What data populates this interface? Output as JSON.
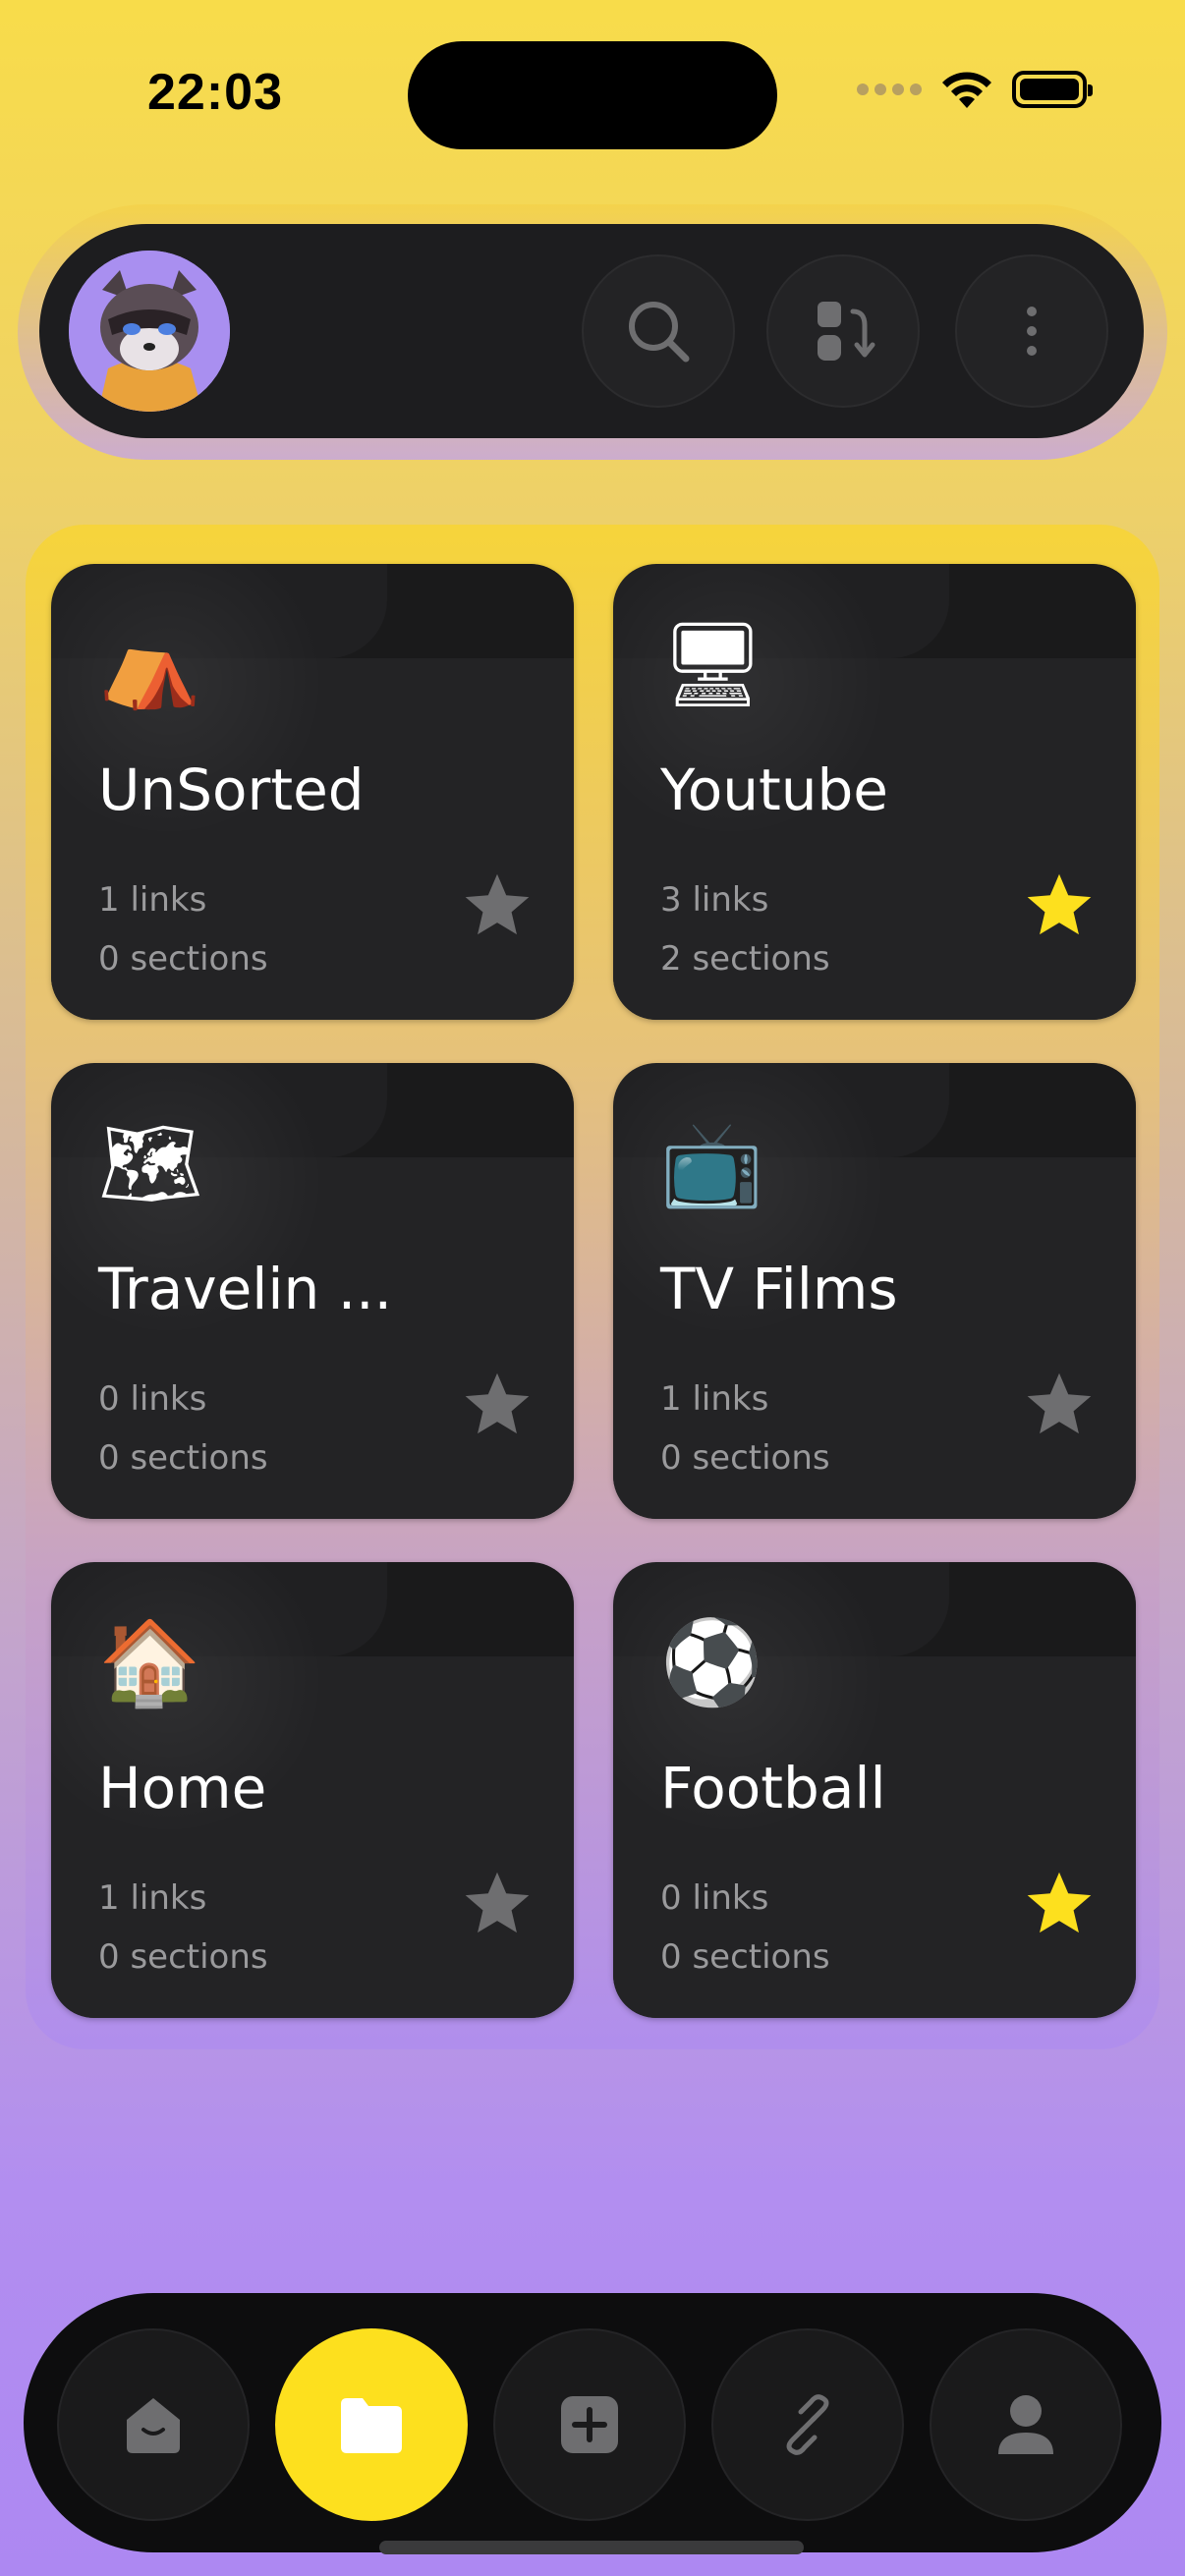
{
  "status_bar": {
    "time": "22:03"
  },
  "top_bar": {
    "avatar_icon": "raccoon-avatar-icon",
    "buttons": [
      {
        "icon": "search-icon"
      },
      {
        "icon": "sort-icon"
      },
      {
        "icon": "more-vertical-icon"
      }
    ]
  },
  "folders": [
    {
      "emoji": "⛺",
      "icon": "tent-icon",
      "title": "UnSorted",
      "links": "1 links",
      "sections": "0 sections",
      "starred": false
    },
    {
      "emoji": "🖥",
      "icon": "desktop-computer-icon",
      "title": "Youtube",
      "links": "3 links",
      "sections": "2 sections",
      "starred": true
    },
    {
      "emoji": "🗺",
      "icon": "world-map-icon",
      "title": "Travelin ...",
      "links": "0 links",
      "sections": "0 sections",
      "starred": false
    },
    {
      "emoji": "📺",
      "icon": "television-icon",
      "title": "TV Films",
      "links": "1 links",
      "sections": "0 sections",
      "starred": false
    },
    {
      "emoji": "🏠",
      "icon": "house-icon",
      "title": "Home",
      "links": "1 links",
      "sections": "0 sections",
      "starred": false
    },
    {
      "emoji": "⚽",
      "icon": "soccer-ball-icon",
      "title": "Football",
      "links": "0 links",
      "sections": "0 sections",
      "starred": true
    }
  ],
  "colors": {
    "accent_yellow": "#fde01e",
    "star_active": "#fde01e",
    "star_inactive": "#6e6e70",
    "card_bg": "#202022"
  },
  "bottom_nav": [
    {
      "icon": "home-smile-icon",
      "active": false
    },
    {
      "icon": "folder-icon",
      "active": true
    },
    {
      "icon": "add-square-icon",
      "active": false
    },
    {
      "icon": "link-icon",
      "active": false
    },
    {
      "icon": "profile-icon",
      "active": false
    }
  ]
}
